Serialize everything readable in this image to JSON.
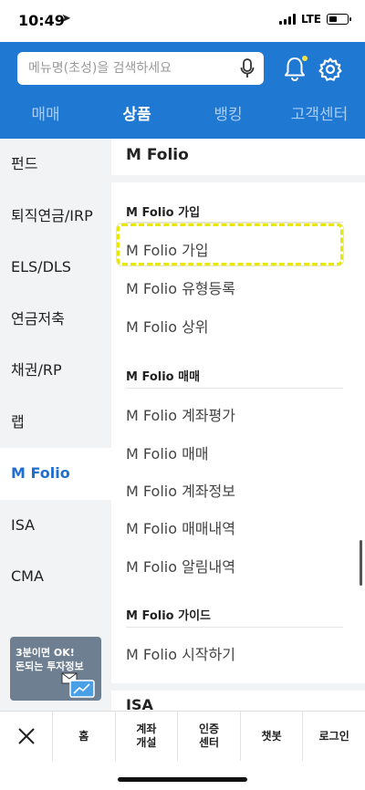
{
  "status": {
    "time": "10:49",
    "location_glyph": "➤",
    "network": "LTE"
  },
  "header": {
    "search": {
      "placeholder": "메뉴명(초성)을 검색하세요",
      "value": ""
    },
    "tabs": [
      {
        "label": "매매",
        "active": false
      },
      {
        "label": "상품",
        "active": true
      },
      {
        "label": "뱅킹",
        "active": false
      },
      {
        "label": "고객센터",
        "active": false
      }
    ],
    "accent": "#1f78d1"
  },
  "sidebar": {
    "items": [
      {
        "label": "펀드"
      },
      {
        "label": "퇴직연금/IRP"
      },
      {
        "label": "ELS/DLS"
      },
      {
        "label": "연금저축"
      },
      {
        "label": "채권/RP"
      },
      {
        "label": "랩"
      },
      {
        "label": "M Folio",
        "active": true
      },
      {
        "label": "ISA"
      },
      {
        "label": "CMA"
      }
    ],
    "promo": {
      "line1": "3분이면 OK!",
      "line2": "돈되는 투자정보"
    }
  },
  "main": {
    "title": "M Folio",
    "sections": [
      {
        "title": "M Folio 가입",
        "items": [
          "M Folio 가입",
          "M Folio 유형등록",
          "M Folio 상위"
        ]
      },
      {
        "title": "M Folio 매매",
        "items": [
          "M Folio 계좌평가",
          "M Folio 매매",
          "M Folio 계좌정보",
          "M Folio 매매내역",
          "M Folio 알림내역"
        ]
      },
      {
        "title": "M Folio 가이드",
        "items": [
          "M Folio 시작하기"
        ]
      }
    ],
    "next_section": "ISA"
  },
  "bottom_nav": {
    "items": [
      "홈",
      "계좌\n개설",
      "인증\n센터",
      "챗봇",
      "로그인"
    ]
  }
}
